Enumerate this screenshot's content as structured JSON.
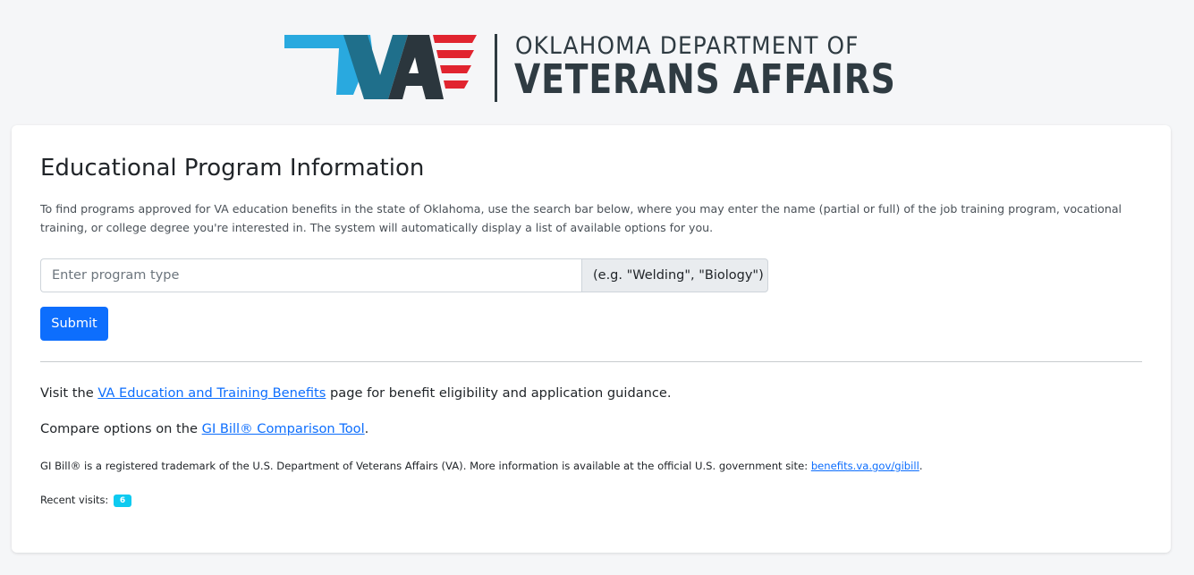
{
  "header": {
    "logo": {
      "mark_text": "VA",
      "line1": "OKLAHOMA DEPARTMENT OF",
      "line2": "VETERANS AFFAIRS"
    },
    "colors": {
      "light_blue": "#29a9df",
      "teal": "#1f6f8b",
      "dark": "#2f3b42",
      "red": "#e1242f"
    }
  },
  "main": {
    "title": "Educational Program Information",
    "intro": "To find programs approved for VA education benefits in the state of Oklahoma, use the search bar below, where you may enter the name (partial or full) of the job training program, vocational training, or college degree you're interested in. The system will automatically display a list of available options for you.",
    "search": {
      "placeholder": "Enter program type",
      "value": "",
      "addon_text": "(e.g. \"Welding\", \"Biology\")"
    },
    "submit_label": "Submit",
    "visit_line": {
      "before": "Visit the ",
      "link_text": "VA Education and Training Benefits",
      "after": " page for benefit eligibility and application guidance."
    },
    "compare_line": {
      "before": "Compare options on the ",
      "link_text": "GI Bill® Comparison Tool",
      "after": "."
    },
    "trademark_line": {
      "before": "GI Bill® is a registered trademark of the U.S. Department of Veterans Affairs (VA). More information is available at the official U.S. government site: ",
      "link_text": "benefits.va.gov/gibill",
      "after": "."
    },
    "recent_visits": {
      "label": "Recent visits:",
      "count": "6"
    },
    "colors": {
      "primary": "#0d6efd",
      "badge": "#0dcaf0"
    }
  }
}
